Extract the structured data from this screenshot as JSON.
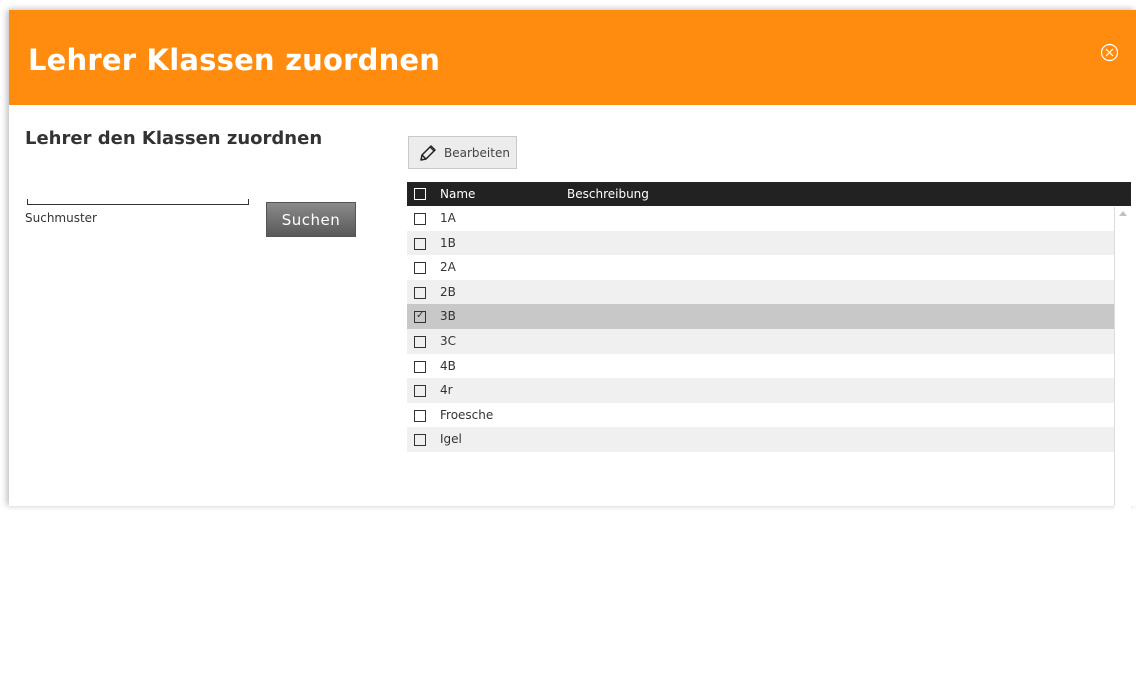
{
  "dialog": {
    "title": "Lehrer Klassen zuordnen",
    "close_icon": "close-circle-icon"
  },
  "left": {
    "title": "Lehrer den Klassen zuordnen",
    "search_value": "",
    "search_label": "Suchmuster",
    "search_button": "Suchen"
  },
  "toolbar": {
    "edit_label": "Bearbeiten",
    "edit_icon": "pencil-icon"
  },
  "table": {
    "columns": [
      "Name",
      "Beschreibung"
    ],
    "rows": [
      {
        "name": "1A",
        "description": "",
        "checked": false
      },
      {
        "name": "1B",
        "description": "",
        "checked": false
      },
      {
        "name": "2A",
        "description": "",
        "checked": false
      },
      {
        "name": "2B",
        "description": "",
        "checked": false
      },
      {
        "name": "3B",
        "description": "",
        "checked": true
      },
      {
        "name": "3C",
        "description": "",
        "checked": false
      },
      {
        "name": "4B",
        "description": "",
        "checked": false
      },
      {
        "name": "4r",
        "description": "",
        "checked": false
      },
      {
        "name": "Froesche",
        "description": "",
        "checked": false
      },
      {
        "name": "Igel",
        "description": "",
        "checked": false
      }
    ]
  },
  "colors": {
    "header": "#ff8c0e",
    "table_header": "#222222",
    "selected_row": "#c8c8c8"
  }
}
